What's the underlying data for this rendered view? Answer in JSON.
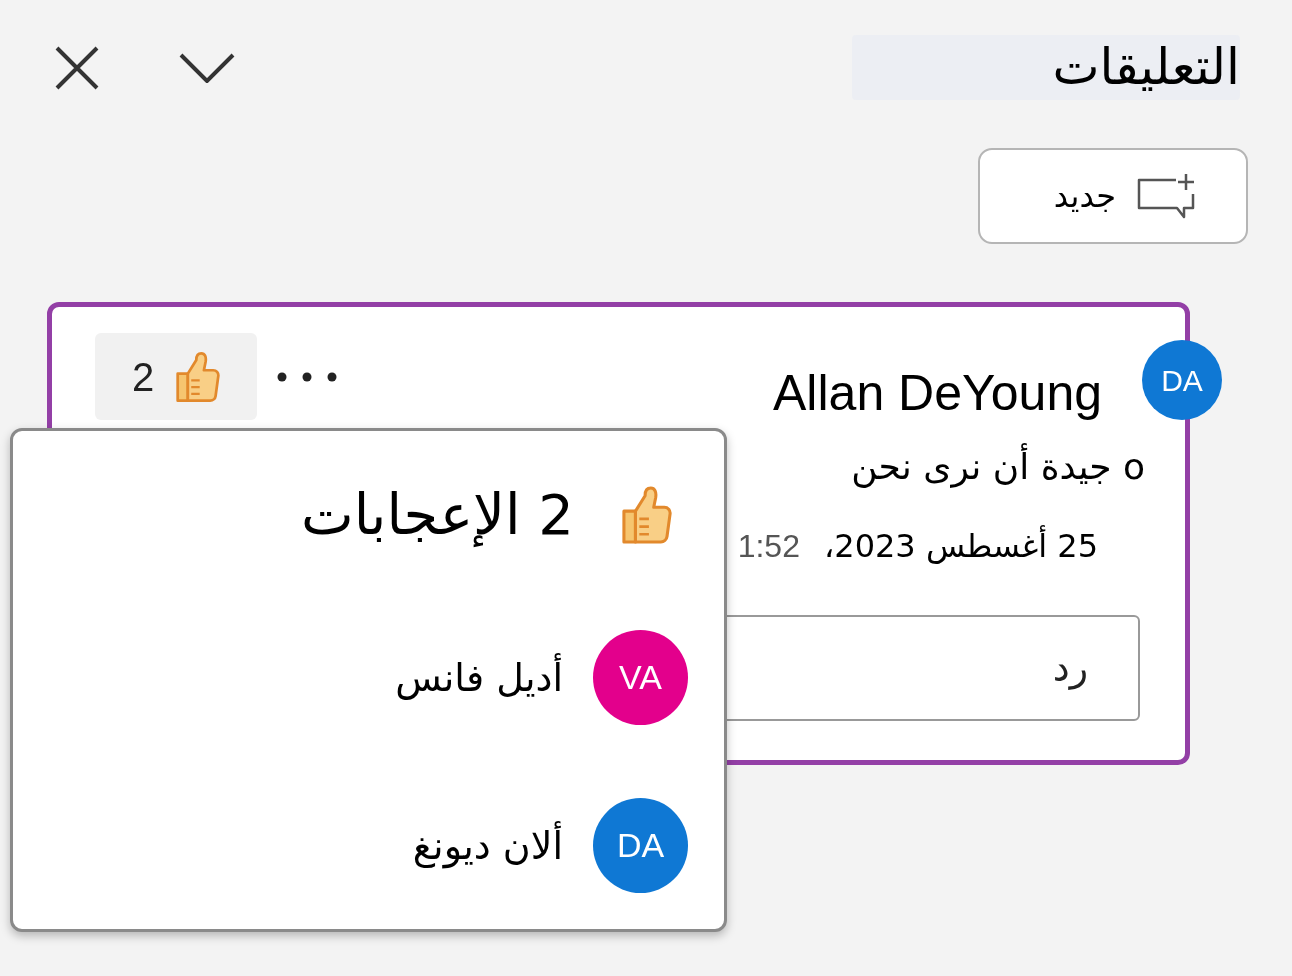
{
  "pane": {
    "title": "التعليقات"
  },
  "new_button": {
    "label": "جديد"
  },
  "comment": {
    "author": "Allan DeYoung",
    "initials": "DA",
    "likes": "2",
    "text": "o جيدة أن نرى نحن",
    "time": "1:52",
    "date": "25 أغسطس 2023،",
    "reply": {
      "placeholder": "رد"
    }
  },
  "reactions_popup": {
    "title": "2 الإعجابات",
    "people": [
      {
        "name": "أديل فانس",
        "initials": "VA",
        "color": "#e3008c"
      },
      {
        "name": "ألان ديونغ",
        "initials": "DA",
        "color": "#0f78d4"
      }
    ]
  }
}
